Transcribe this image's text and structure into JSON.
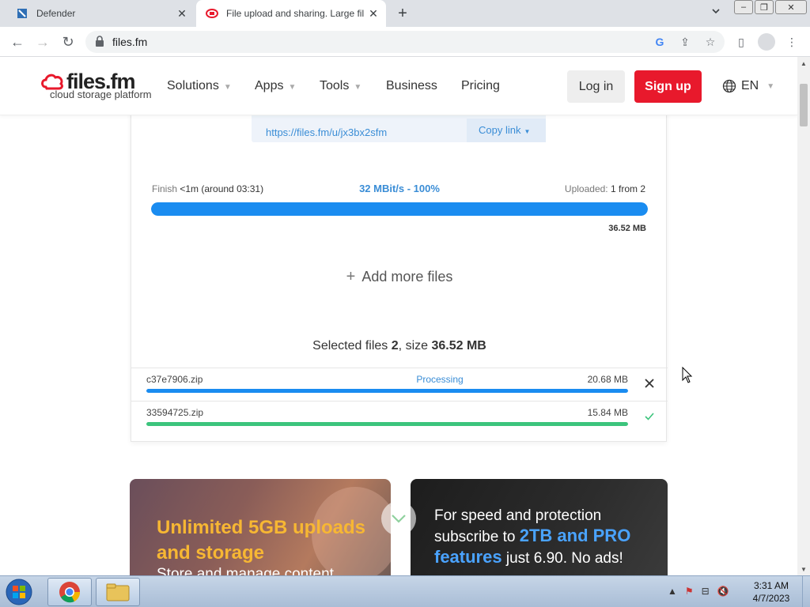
{
  "browser": {
    "tabs": [
      {
        "title": "Defender",
        "active": false
      },
      {
        "title": "File upload and sharing. Large fil",
        "active": true
      }
    ],
    "url": "files.fm"
  },
  "site": {
    "logo_text": "files.fm",
    "logo_sub": "cloud storage platform",
    "nav": [
      "Solutions",
      "Apps",
      "Tools",
      "Business",
      "Pricing"
    ],
    "login": "Log in",
    "signup": "Sign up",
    "lang": "EN"
  },
  "upload": {
    "share_url": "https://files.fm/u/jx3bx2sfm",
    "copy_link": "Copy link",
    "finish_label": "Finish",
    "finish_value": "<1m (around 03:31)",
    "speed": "32 MBit/s - 100%",
    "uploaded_label": "Uploaded:",
    "uploaded_value": "1 from 2",
    "progress": 1.0,
    "total_size": "36.52 MB",
    "add_more": "Add more files",
    "selected_prefix": "Selected files",
    "selected_count": "2",
    "selected_mid": ", size",
    "selected_size": "36.52 MB",
    "files": [
      {
        "name": "c37e7906.zip",
        "status": "Processing",
        "size": "20.68 MB",
        "progress": 1.0,
        "color": "#1a8cf0",
        "action": "close"
      },
      {
        "name": "33594725.zip",
        "status": "",
        "size": "15.84 MB",
        "progress": 1.0,
        "color": "#3cc47c",
        "action": "check"
      }
    ]
  },
  "promos": {
    "left_title_1": "Unlimited 5GB uploads",
    "left_title_2": "and storage",
    "left_sub": "Store and manage content",
    "right_line1": "For speed and protection",
    "right_line2": "subscribe to",
    "right_hl1": "2TB and PRO",
    "right_hl2": "features",
    "right_tail": "just 6.90. No ads!"
  },
  "taskbar": {
    "time": "3:31 AM",
    "date": "4/7/2023"
  },
  "colors": {
    "accent_blue": "#1a8cf0",
    "signup_red": "#e8192c",
    "success_green": "#3cc47c",
    "promo_yellow": "#f7b733"
  }
}
